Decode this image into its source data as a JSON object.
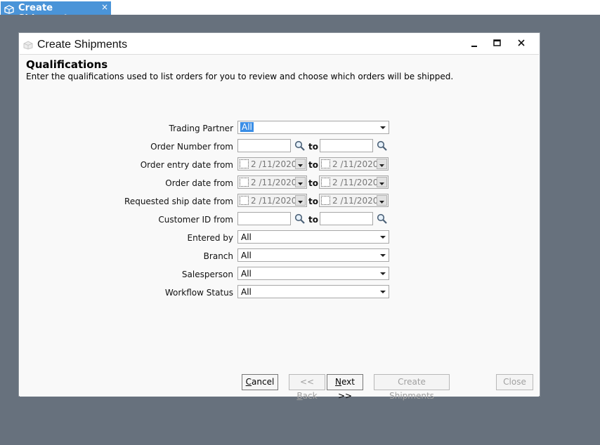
{
  "tab": {
    "label": "Create Shipments",
    "close_glyph": "×",
    "icon": "package-icon"
  },
  "window": {
    "title": "Create Shipments",
    "icon": "package-icon"
  },
  "content": {
    "heading": "Qualifications",
    "description": "Enter the qualifications used to list orders for you to review and choose which orders will be shipped."
  },
  "form": {
    "trading_partner": {
      "label": "Trading Partner",
      "value": "All"
    },
    "order_number": {
      "label": "Order Number from",
      "from": "",
      "to_label": "to",
      "to": ""
    },
    "order_entry_date": {
      "label": "Order entry date from",
      "from": "2 /11/2020",
      "to_label": "to",
      "to": "2 /11/2020"
    },
    "order_date": {
      "label": "Order date from",
      "from": "2 /11/2020",
      "to_label": "to",
      "to": "2 /11/2020"
    },
    "requested_ship_date": {
      "label": "Requested ship date from",
      "from": "2 /11/2020",
      "to_label": "to",
      "to": "2 /11/2020"
    },
    "customer_id": {
      "label": "Customer ID from",
      "from": "",
      "to_label": "to",
      "to": ""
    },
    "entered_by": {
      "label": "Entered by",
      "value": "All"
    },
    "branch": {
      "label": "Branch",
      "value": "All"
    },
    "salesperson": {
      "label": "Salesperson",
      "value": "All"
    },
    "workflow_status": {
      "label": "Workflow Status",
      "value": "All"
    }
  },
  "buttons": {
    "cancel": {
      "mnemonic": "C",
      "rest": "ancel"
    },
    "back": {
      "prefix": "<< ",
      "mnemonic": "B",
      "rest": "ack"
    },
    "next": {
      "mnemonic": "N",
      "rest": "ext >>"
    },
    "create_shipments": "Create Shipments",
    "close": "Close"
  },
  "colors": {
    "accent": "#4a94d8",
    "workspace": "#67717d",
    "selection": "#3a8ee6"
  }
}
